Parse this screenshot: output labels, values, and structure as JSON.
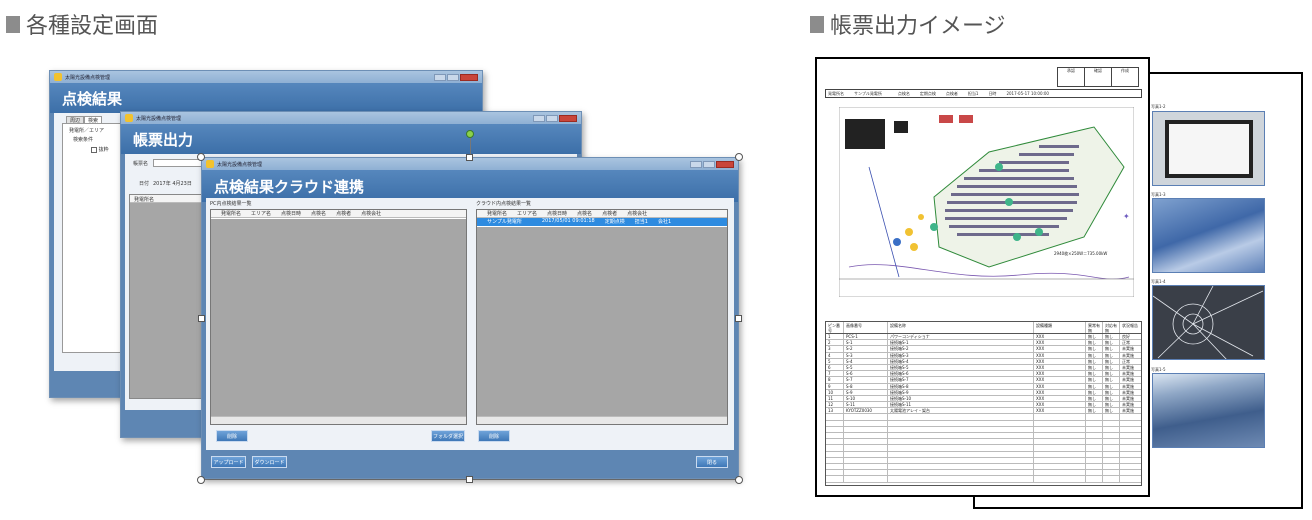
{
  "headings": {
    "left": "各種設定画面",
    "right": "帳票出力イメージ"
  },
  "app_title": "太陽光設備点検管理",
  "back_window": {
    "banner": "点検結果",
    "tabs": [
      "周辺",
      "検索"
    ],
    "field_label": "発電所／エリア",
    "cond_label": "検索条件",
    "check_text": "抜粋"
  },
  "mid_window": {
    "banner": "帳票出力",
    "field_label": "帳票名",
    "date_label": "日付",
    "date_value": "2017年 4月23日",
    "col_header": "発電所名"
  },
  "front_window": {
    "banner": "点検結果クラウド連携",
    "left_panel_label": "PC内点検結果一覧",
    "right_panel_label": "クラウド内点検結果一覧",
    "left_columns": [
      "発電所名",
      "エリア名",
      "点検日時",
      "点検名",
      "点検者",
      "点検会社"
    ],
    "right_columns": [
      "発電所名",
      "エリア名",
      "点検日時",
      "点検名",
      "点検者",
      "点検会社"
    ],
    "right_row": [
      "サンプル発電所",
      "",
      "2017/05/01 09:01:18",
      "定期点検",
      "担当1",
      "会社1"
    ],
    "buttons": {
      "left_delete": "削除",
      "folder_select": "フォルダ選択",
      "right_delete": "削除",
      "upload": "アップロード",
      "download": "ダウンロード",
      "close": "閉る"
    }
  },
  "report": {
    "stamp_cells": [
      "承認",
      "確認",
      "作成"
    ],
    "info_row": [
      "発電所名",
      "サンプル発電所",
      "点検名",
      "定期点検",
      "点検者",
      "担当1",
      "日時",
      "2017-05-17 10:00:00"
    ],
    "drawing_note": "2940枚×250W＝735.00kW",
    "table_headers": [
      "ピン番号",
      "画像番号",
      "設備名称",
      "設備種類",
      "異常有無",
      "対応有無",
      "状況報告"
    ],
    "rows": [
      [
        "1",
        "PCS-1",
        "パワーコンディショナ",
        "XXX",
        "無し",
        "無し",
        "良好"
      ],
      [
        "2",
        "S-1",
        "接続箱S-1",
        "XXX",
        "無し",
        "無し",
        "正常"
      ],
      [
        "3",
        "S-2",
        "接続箱S-2",
        "XXX",
        "無し",
        "無し",
        "未実施"
      ],
      [
        "4",
        "S-3",
        "接続箱S-3",
        "XXX",
        "無し",
        "無し",
        "未実施"
      ],
      [
        "5",
        "S-4",
        "接続箱S-4",
        "XXX",
        "無し",
        "無し",
        "正常"
      ],
      [
        "6",
        "S-5",
        "接続箱S-5",
        "XXX",
        "無し",
        "無し",
        "未実施"
      ],
      [
        "7",
        "S-6",
        "接続箱S-6",
        "XXX",
        "無し",
        "無し",
        "未実施"
      ],
      [
        "8",
        "S-7",
        "接続箱S-7",
        "XXX",
        "無し",
        "無し",
        "未実施"
      ],
      [
        "9",
        "S-8",
        "接続箱S-8",
        "XXX",
        "無し",
        "無し",
        "未実施"
      ],
      [
        "10",
        "S-9",
        "接続箱S-9",
        "XXX",
        "無し",
        "無し",
        "未実施"
      ],
      [
        "11",
        "S-10",
        "接続箱S-10",
        "XXX",
        "無し",
        "無し",
        "未実施"
      ],
      [
        "12",
        "S-11",
        "接続箱S-11",
        "XXX",
        "無し",
        "無し",
        "未実施"
      ],
      [
        "13",
        "KYOTZZ0030",
        "太陽電池アレイ・架台",
        "XXX",
        "無し",
        "無し",
        "未実施"
      ]
    ],
    "photo_labels": [
      "写真1-2",
      "写真1-3",
      "写真1-4",
      "写真1-5"
    ]
  },
  "colors": {
    "banner": "#3c6fa8",
    "selection": "#2e8be0",
    "panel_grey": "#a6a6a6"
  }
}
